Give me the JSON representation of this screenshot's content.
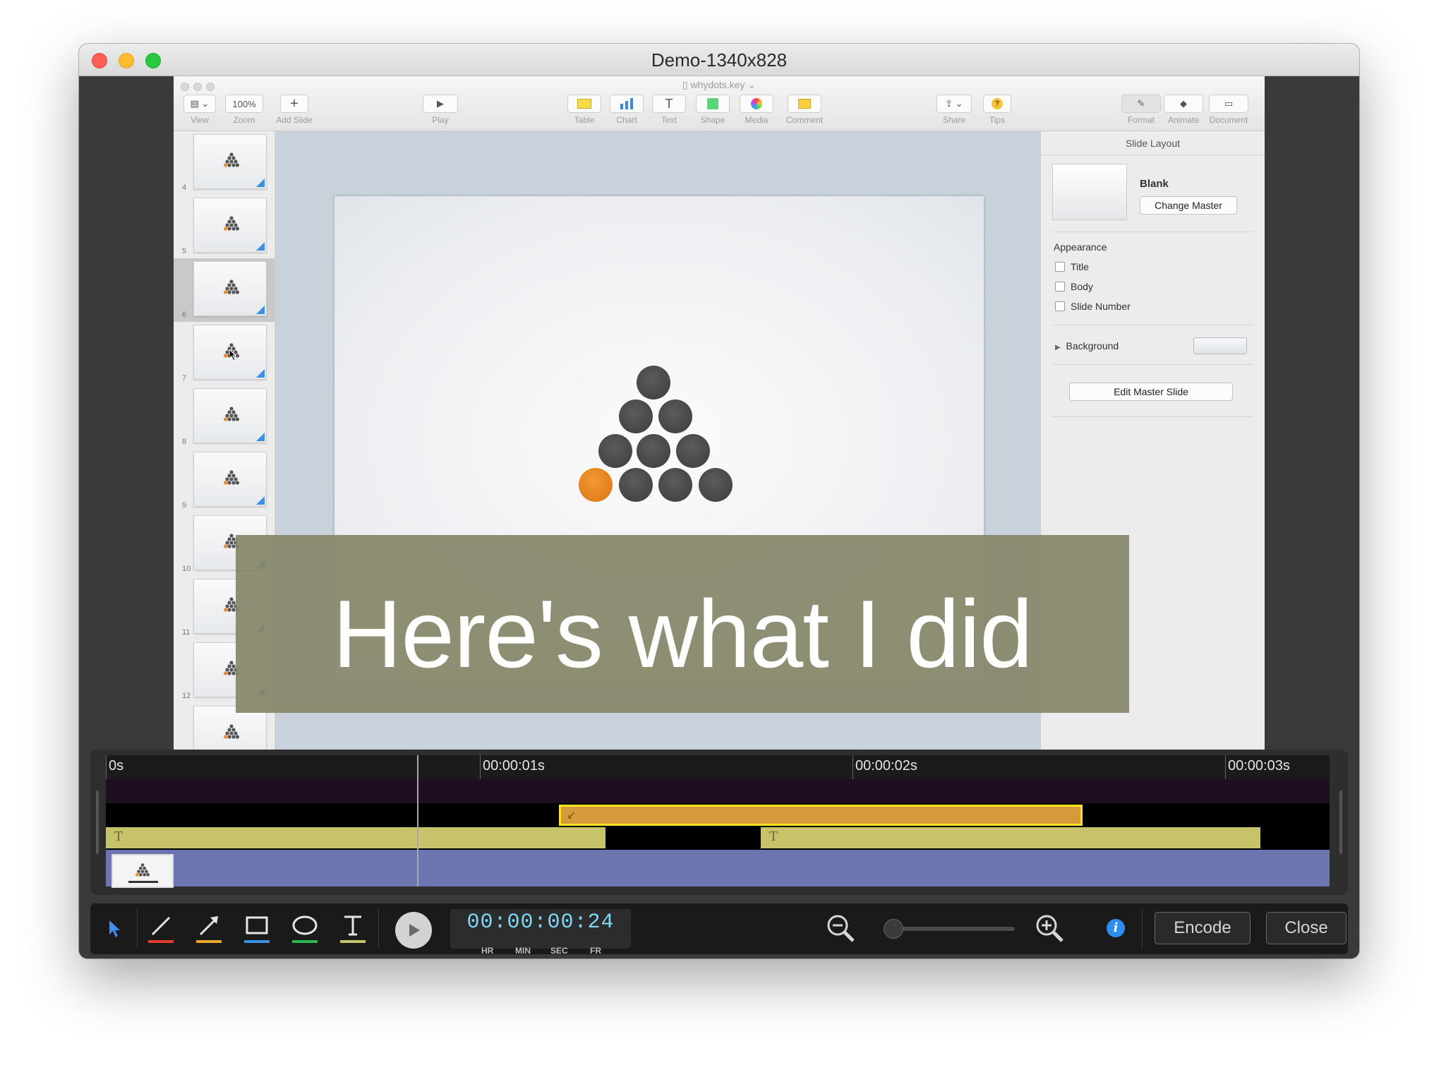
{
  "window": {
    "title": "Demo-1340x828"
  },
  "keynote": {
    "document_name": "whydots.key",
    "toolbar": {
      "view": {
        "label": "View"
      },
      "zoom": {
        "label": "Zoom",
        "value": "100%"
      },
      "add_slide": {
        "label": "Add Slide"
      },
      "play": {
        "label": "Play"
      },
      "table": {
        "label": "Table"
      },
      "chart": {
        "label": "Chart"
      },
      "text": {
        "label": "Text"
      },
      "shape": {
        "label": "Shape"
      },
      "media": {
        "label": "Media"
      },
      "comment": {
        "label": "Comment"
      },
      "share": {
        "label": "Share"
      },
      "tips": {
        "label": "Tips"
      },
      "format": {
        "label": "Format"
      },
      "animate": {
        "label": "Animate"
      },
      "document": {
        "label": "Document"
      }
    },
    "navigator": {
      "slides": [
        {
          "number": "4"
        },
        {
          "number": "5"
        },
        {
          "number": "6",
          "selected": true
        },
        {
          "number": "7"
        },
        {
          "number": "8"
        },
        {
          "number": "9"
        },
        {
          "number": "10"
        },
        {
          "number": "11"
        },
        {
          "number": "12"
        },
        {
          "number": ""
        }
      ]
    },
    "inspector": {
      "title": "Slide Layout",
      "master_name": "Blank",
      "change_master": "Change Master",
      "appearance_heading": "Appearance",
      "checkboxes": [
        {
          "label": "Title",
          "checked": false
        },
        {
          "label": "Body",
          "checked": false
        },
        {
          "label": "Slide Number",
          "checked": false
        }
      ],
      "background_label": "Background",
      "edit_master": "Edit Master Slide"
    },
    "slide": {
      "accent_color": "#ef8a26",
      "dot_color": "#555555"
    }
  },
  "caption": {
    "text": "Here's what I did"
  },
  "timeline": {
    "ticks": [
      {
        "label": "0s",
        "seconds": 0
      },
      {
        "label": "00:00:01s",
        "seconds": 1
      },
      {
        "label": "00:00:02s",
        "seconds": 2
      },
      {
        "label": "00:00:03s",
        "seconds": 3
      }
    ],
    "text_clip_icon": "T",
    "arrow_clip_icon": "↙"
  },
  "bottombar": {
    "timecode": "00:00:00:24",
    "units": {
      "hr": "HR",
      "min": "MIN",
      "sec": "SEC",
      "fr": "FR"
    },
    "encode_label": "Encode",
    "close_label": "Close",
    "info_label": "i"
  }
}
